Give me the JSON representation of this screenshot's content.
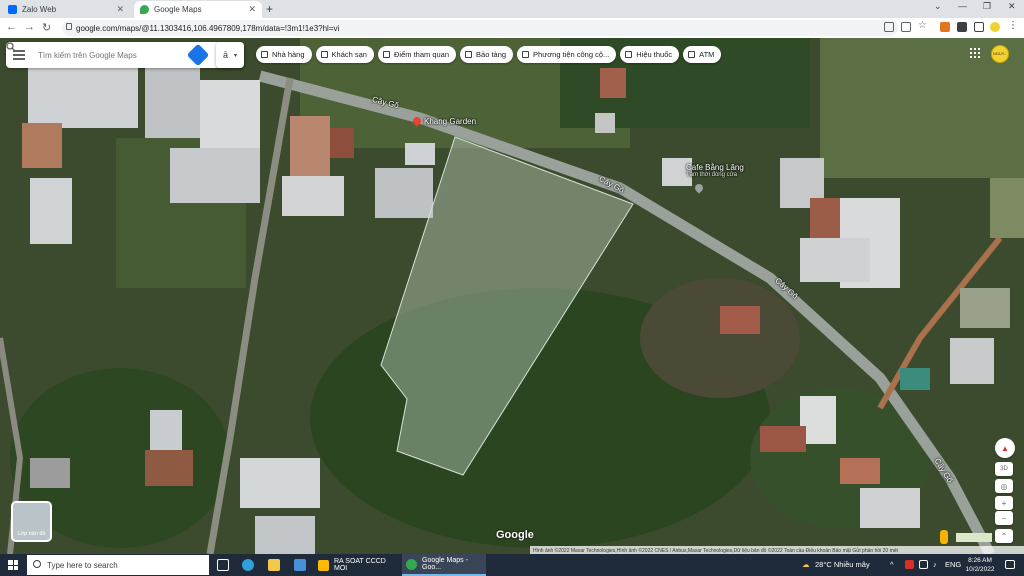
{
  "browser": {
    "tabs": [
      {
        "title": "Zalo Web",
        "favicon_color": "#0068ff"
      },
      {
        "title": "Google Maps",
        "favicon_color": "#34a853"
      }
    ],
    "new_tab_symbol": "+",
    "close_symbol": "✕",
    "window_controls": {
      "chevron": "⌄",
      "minimize": "—",
      "restore": "❐",
      "close": "✕"
    },
    "address": "google.com/maps/@11.1303416,106.4967809,178m/data=!3m1!1e3?hl=vi"
  },
  "maps": {
    "search_placeholder": "Tìm kiếm trên Google Maps",
    "trip_label": "ā",
    "chips": [
      {
        "label": "Nhà hàng",
        "icon": "fork-knife-icon"
      },
      {
        "label": "Khách sạn",
        "icon": "bed-icon"
      },
      {
        "label": "Điểm tham quan",
        "icon": "camera-icon"
      },
      {
        "label": "Bảo tàng",
        "icon": "museum-icon"
      },
      {
        "label": "Phương tiện công cộ...",
        "icon": "bus-icon"
      },
      {
        "label": "Hiệu thuốc",
        "icon": "pharmacy-icon"
      },
      {
        "label": "ATM",
        "icon": "atm-icon"
      }
    ],
    "avatar_text": "NGUY...",
    "road_labels": [
      "Cây Gõ",
      "Cây Gõ",
      "Cây Gõ",
      "Cây Gõ"
    ],
    "pois": [
      {
        "name": "Khang Garden",
        "sub": "",
        "pin_color": "#ea4335"
      },
      {
        "name": "Cafe Bằng Lăng",
        "sub": "Tạm thời đóng cửa",
        "pin_color": "#9aa0a6"
      }
    ],
    "layers_label": "Lớp bản đồ",
    "google_logo": "Google",
    "attribution": "Hình ảnh ©2022 Maxar Technologies,Hình ảnh ©2022 CNES / Airbus,Maxar Technologies,Dữ liệu bản đồ ©2022   Toàn cầu   Điều khoản   Bảo mật   Gửi phản hồi   20 mét",
    "controls": {
      "zoom_in": "+",
      "zoom_out": "−",
      "tilt": "3D"
    },
    "colors": {
      "polygon_fill": "#b7c9b7",
      "road": "#9aa19a",
      "accent": "#1a73e8"
    }
  },
  "taskbar": {
    "search_placeholder": "Type here to search",
    "apps": [
      {
        "label": "RA SOAT CCCD MOI",
        "active": false,
        "color": "#ffb900"
      },
      {
        "label": "Google Maps - Goo...",
        "active": true,
        "color": "#34a853"
      }
    ],
    "weather": "28°C  Nhiều mây",
    "tray_up_arrow": "^",
    "language": "ENG",
    "time": "8:26 AM",
    "date": "10/2/2022"
  }
}
